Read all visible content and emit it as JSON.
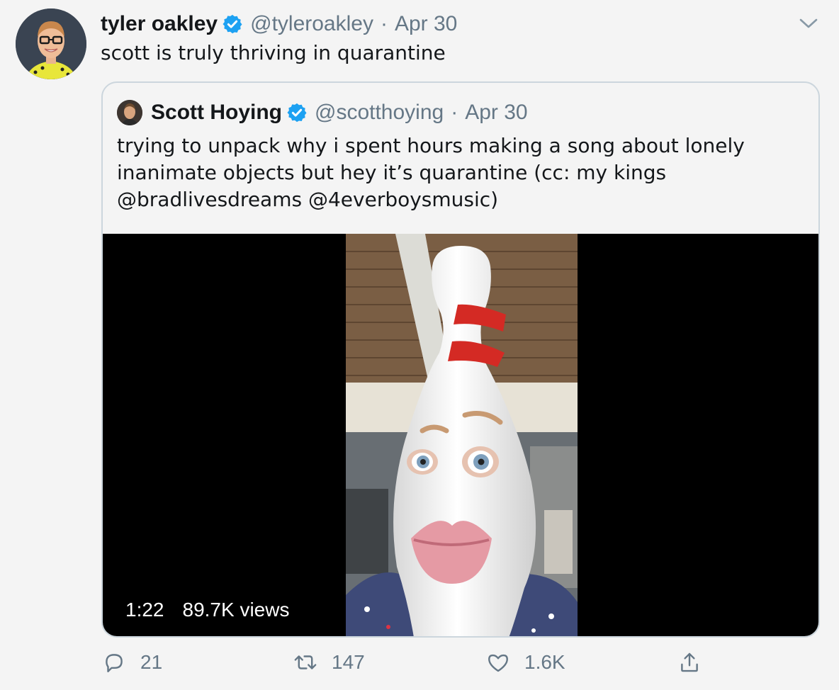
{
  "tweet": {
    "author_name": "tyler oakley",
    "handle": "@tyleroakley",
    "separator": "·",
    "date": "Apr 30",
    "text": "scott is truly thriving in quarantine"
  },
  "quoted_tweet": {
    "author_name": "Scott Hoying",
    "handle": "@scotthoying",
    "separator": "·",
    "date": "Apr 30",
    "text_lines": [
      "trying to unpack why i spent hours making a song about lonely",
      "inanimate objects but hey it’s quarantine (cc: my kings",
      "@bradlivesdreams @4everboysmusic)"
    ],
    "video": {
      "duration": "1:22",
      "views": "89.7K views"
    }
  },
  "actions": {
    "replies": "21",
    "retweets": "147",
    "likes": "1.6K"
  },
  "icons": [
    "verified-icon",
    "chevron-down-icon",
    "reply-icon",
    "retweet-icon",
    "like-icon",
    "share-icon"
  ],
  "colors": {
    "background": "#f4f4f4",
    "text": "#14171a",
    "secondary": "#657786",
    "verified": "#1da1f2",
    "border": "#ccd6dd"
  }
}
